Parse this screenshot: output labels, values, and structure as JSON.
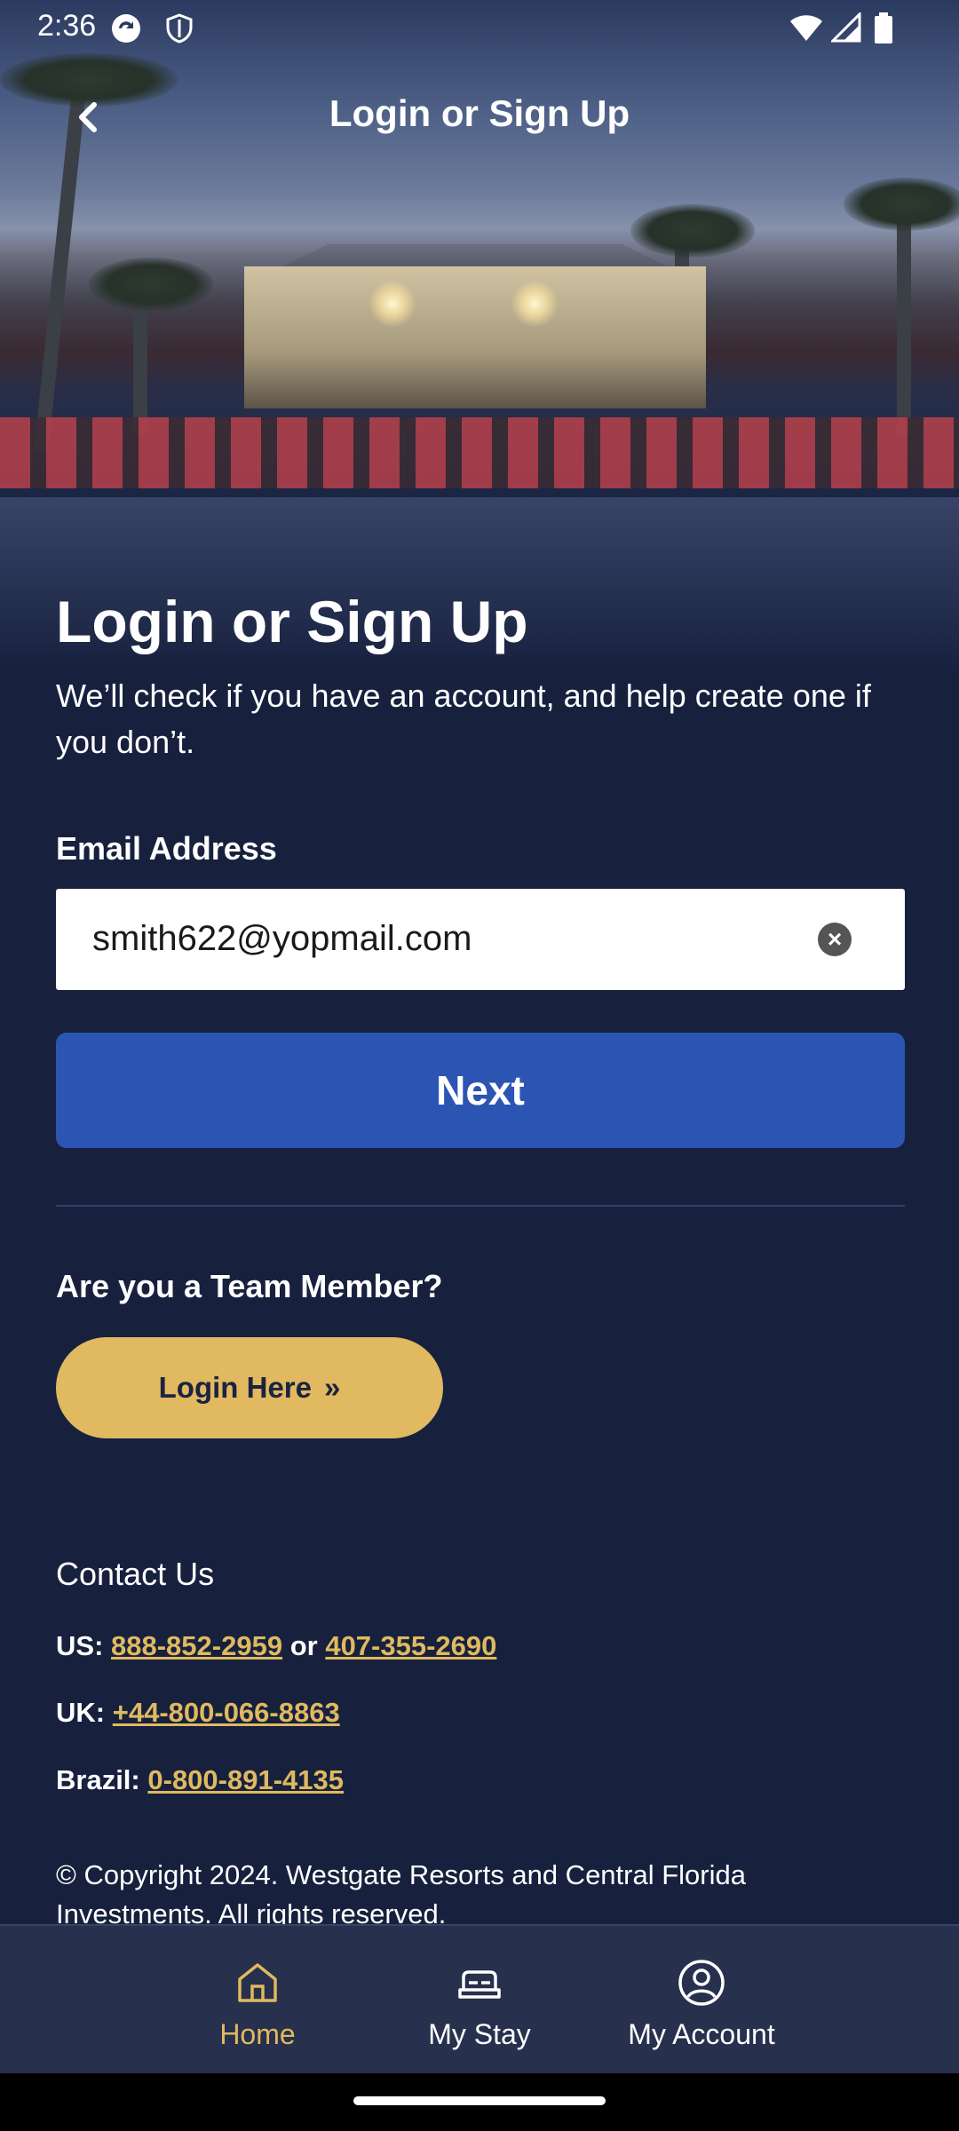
{
  "status_bar": {
    "time": "2:36"
  },
  "top_bar": {
    "title": "Login or Sign Up"
  },
  "main": {
    "title": "Login or Sign Up",
    "subtitle": "We’ll check if you have an account, and help create one if you don’t.",
    "email_label": "Email Address",
    "email_value": "smith622@yopmail.com",
    "next_label": "Next",
    "team_question": "Are you a Team Member?",
    "login_here_label": "Login Here",
    "login_here_chevron": "»"
  },
  "contact": {
    "title": "Contact Us",
    "us_prefix": "US:",
    "us_phone_1": "888-852-2959",
    "us_or": "or",
    "us_phone_2": "407-355-2690",
    "uk_prefix": "UK:",
    "uk_phone": "+44-800-066-8863",
    "brazil_prefix": "Brazil:",
    "brazil_phone": "0-800-891-4135"
  },
  "copyright": "© Copyright 2024. Westgate Resorts and Central Florida Investments. All rights reserved.",
  "bottom_nav": {
    "items": [
      {
        "label": "Home",
        "icon": "home-icon",
        "active": true
      },
      {
        "label": "My Stay",
        "icon": "bed-icon",
        "active": false
      },
      {
        "label": "My Account",
        "icon": "account-icon",
        "active": false
      }
    ]
  },
  "colors": {
    "background": "#17213e",
    "primary_button": "#2c55b3",
    "accent_gold": "#e0b960",
    "nav_background": "#27304c"
  }
}
